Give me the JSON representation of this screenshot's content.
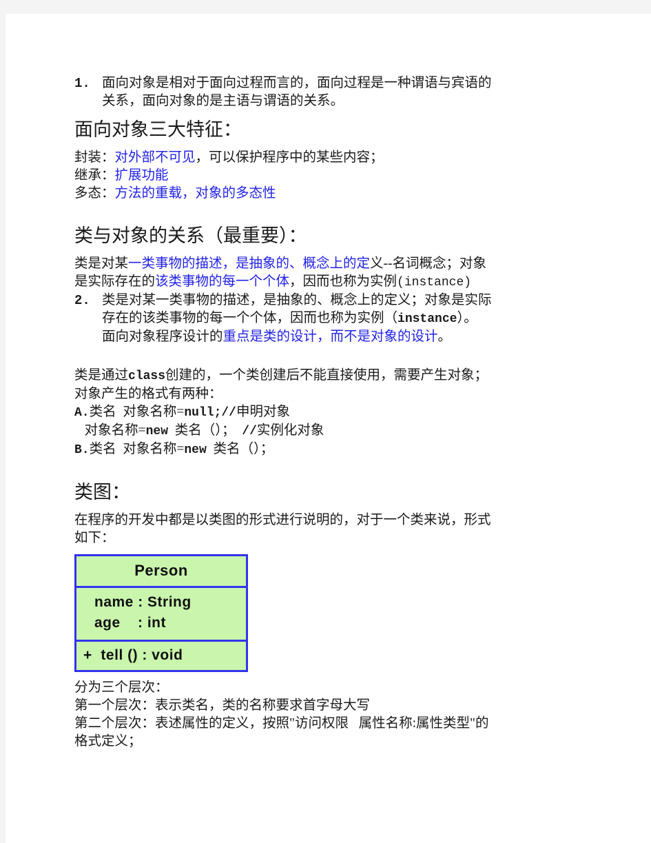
{
  "document": {
    "page_bg": "#f4f4f4",
    "paper_bg": "#ffffff",
    "accent_blue": "#2222e8",
    "uml_border": "#3333ee",
    "uml_fill": "#c9f5ad"
  },
  "blocks": {
    "item1": {
      "marker": "1.",
      "line1": "面向对象是相对于面向过程而言的，面向过程是一种谓语与宾语的",
      "line2": "关系，面向对象的是主语与谓语的关系。"
    },
    "heading_features": "面向对象三大特征：",
    "features": {
      "encapsulation_label": "封装：",
      "encapsulation_blue": "对外部不可见",
      "encapsulation_rest": "，可以保护程序中的某些内容；",
      "inheritance_label": "继承：",
      "inheritance_blue": "扩展功能",
      "polymorphism_label": "多态：",
      "polymorphism_blue": "方法的重载，对象的多态性"
    },
    "heading_class_object": "类与对象的关系（最重要）：",
    "class_object_para": {
      "l1_black_a": "类是对某",
      "l1_blue": "一类事物的描述，是抽象的、概念上的定",
      "l1_black_b": "义--名词概念；对象",
      "l2_black_a": "是实际存在的",
      "l2_blue": "该类事物的每一个个体",
      "l2_black_b": "，因而也称为实例",
      "l2_mono": "(instance)"
    },
    "item2": {
      "marker": "2.",
      "line1": "类是对某一类事物的描述，是抽象的、概念上的定义；对象是实际",
      "line2_a": "存在的该类事物的每一个个体，因而也称为实例（",
      "line2_mono": "instance",
      "line2_b": "）。",
      "line3_black": "面向对象程序设计的",
      "line3_blue": "重点是类的设计，而不是对象的设计",
      "line3_end": "。"
    },
    "creation": {
      "l1_a": "类是通过",
      "l1_mono": "class",
      "l1_b": "创建的，一个类创建后不能直接使用，需要产生对象；",
      "l2": "对象产生的格式有两种：",
      "a_mark": "A.",
      "a_text_a": "类名  对象名称=",
      "a_text_mono": "null;//",
      "a_text_b": "申明对象",
      "a_cont_a": "对象名称=",
      "a_cont_mono": "new",
      "a_cont_b": "  类名（）；  ",
      "a_cont_mono2": "//",
      "a_cont_c": "实例化对象",
      "b_mark": "B.",
      "b_text_a": "类名  对象名称=",
      "b_text_mono": "new",
      "b_text_b": "  类名（）；"
    },
    "heading_class_diagram": "类图：",
    "class_diagram_intro": {
      "line1": "在程序的开发中都是以类图的形式进行说明的，对于一个类来说，形式",
      "line2": "如下："
    },
    "uml": {
      "class_name": "Person",
      "attributes": [
        "name : String",
        "age    : int"
      ],
      "operations": [
        "+  tell () : void"
      ]
    },
    "layers": {
      "intro": "分为三个层次：",
      "layer1": "第一个层次：表示类名，类的名称要求首字母大写",
      "layer2_line1": "第二个层次：表述属性的定义，按照\"访问权限   属性名称:属性类型\"的",
      "layer2_line2": "格式定义；"
    }
  }
}
